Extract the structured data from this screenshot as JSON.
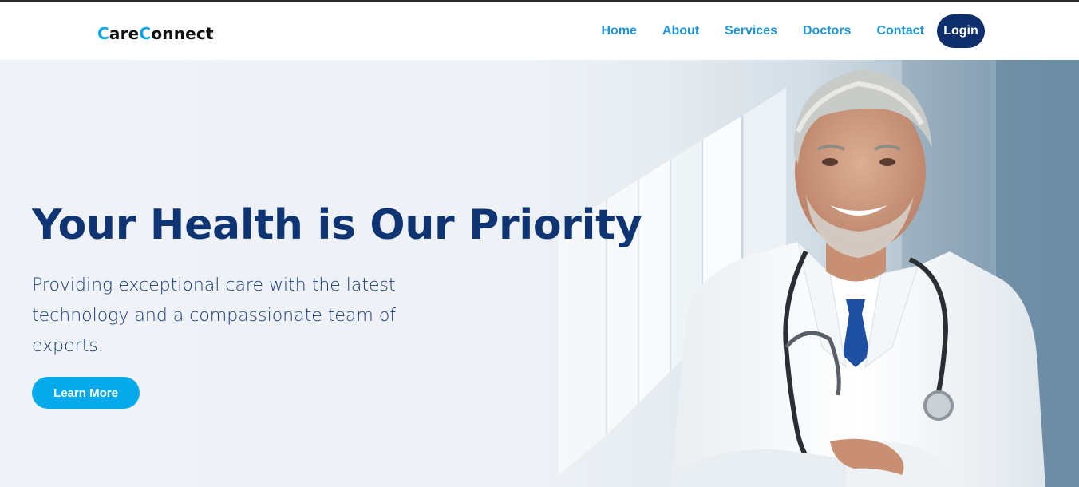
{
  "brand": {
    "logo_part1": "C",
    "logo_part2": "are",
    "logo_part3": "C",
    "logo_part4": "onnect"
  },
  "nav": {
    "items": [
      {
        "label": "Home"
      },
      {
        "label": "About"
      },
      {
        "label": "Services"
      },
      {
        "label": "Doctors"
      },
      {
        "label": "Contact"
      }
    ],
    "login_label": "Login"
  },
  "hero": {
    "title": "Your Health is Our Priority",
    "subtitle": "Providing exceptional care with the latest technology and a compassionate team of experts.",
    "cta_label": "Learn More",
    "image": "doctor-portrait-image"
  },
  "colors": {
    "brand_blue": "#13a6e6",
    "nav_link": "#1f95d8",
    "navy": "#0e3473",
    "login_bg": "#0e2f6b",
    "cta_bg": "#06aaeb"
  }
}
